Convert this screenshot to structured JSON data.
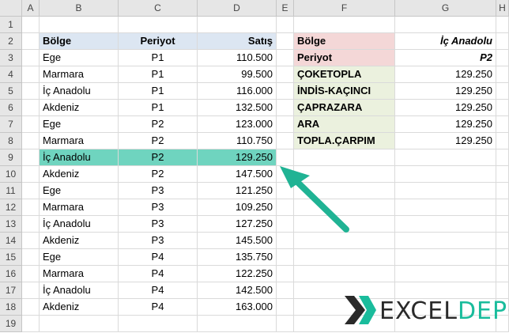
{
  "columns": [
    "A",
    "B",
    "C",
    "D",
    "E",
    "F",
    "G",
    "H"
  ],
  "rows": [
    "1",
    "2",
    "3",
    "4",
    "5",
    "6",
    "7",
    "8",
    "9",
    "10",
    "11",
    "12",
    "13",
    "14",
    "15",
    "16",
    "17",
    "18",
    "19"
  ],
  "table": {
    "headers": {
      "region": "Bölge",
      "period": "Periyot",
      "sales": "Satış"
    },
    "rows": [
      {
        "region": "Ege",
        "period": "P1",
        "sales": "110.500"
      },
      {
        "region": "Marmara",
        "period": "P1",
        "sales": "99.500"
      },
      {
        "region": "İç Anadolu",
        "period": "P1",
        "sales": "116.000"
      },
      {
        "region": "Akdeniz",
        "period": "P1",
        "sales": "132.500"
      },
      {
        "region": "Ege",
        "period": "P2",
        "sales": "123.000"
      },
      {
        "region": "Marmara",
        "period": "P2",
        "sales": "110.750"
      },
      {
        "region": "İç Anadolu",
        "period": "P2",
        "sales": "129.250"
      },
      {
        "region": "Akdeniz",
        "period": "P2",
        "sales": "147.500"
      },
      {
        "region": "Ege",
        "period": "P3",
        "sales": "121.250"
      },
      {
        "region": "Marmara",
        "period": "P3",
        "sales": "109.250"
      },
      {
        "region": "İç Anadolu",
        "period": "P3",
        "sales": "127.250"
      },
      {
        "region": "Akdeniz",
        "period": "P3",
        "sales": "145.500"
      },
      {
        "region": "Ege",
        "period": "P4",
        "sales": "135.750"
      },
      {
        "region": "Marmara",
        "period": "P4",
        "sales": "122.250"
      },
      {
        "region": "İç Anadolu",
        "period": "P4",
        "sales": "142.500"
      },
      {
        "region": "Akdeniz",
        "period": "P4",
        "sales": "163.000"
      }
    ]
  },
  "lookup": {
    "region_label": "Bölge",
    "region_value": "İç Anadolu",
    "period_label": "Periyot",
    "period_value": "P2"
  },
  "results": [
    {
      "label": "ÇOKETOPLA",
      "value": "129.250"
    },
    {
      "label": "İNDİS-KAÇINCI",
      "value": "129.250"
    },
    {
      "label": "ÇAPRAZARA",
      "value": "129.250"
    },
    {
      "label": "ARA",
      "value": "129.250"
    },
    {
      "label": "TOPLA.ÇARPIM",
      "value": "129.250"
    }
  ],
  "logo": {
    "part1": "EXCEL",
    "part2": "DEPO"
  },
  "colors": {
    "highlight": "#6fd4bf",
    "arrow": "#20b394",
    "header_blue": "#dce6f2",
    "header_pink": "#f4d7d7",
    "label_green": "#ebf1de"
  }
}
